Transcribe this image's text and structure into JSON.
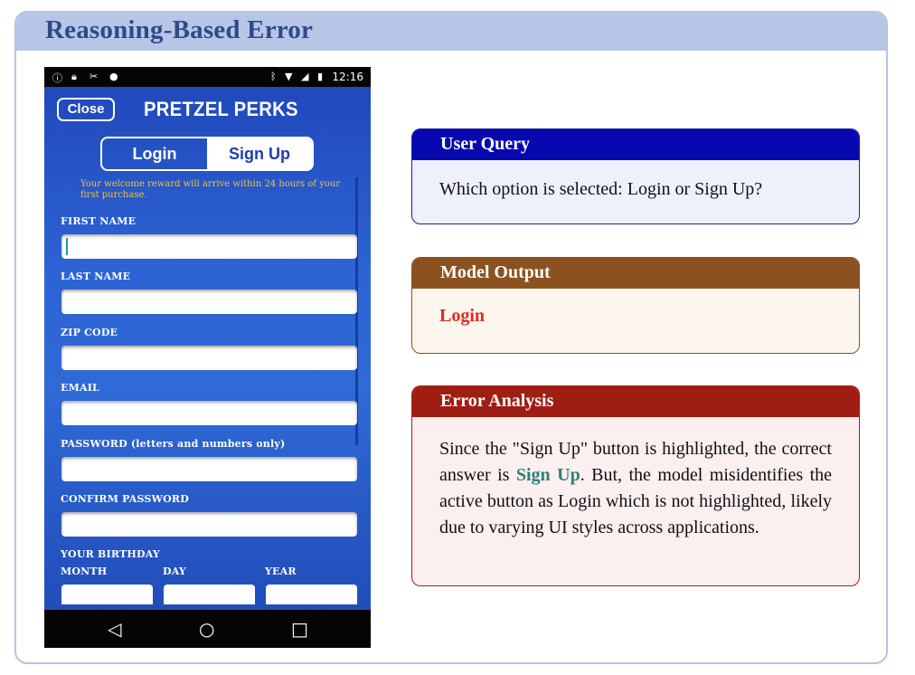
{
  "title": "Reasoning-Based Error",
  "phone": {
    "status_bar": {
      "time": "12:16"
    },
    "close_label": "Close",
    "app_name": "PRETZEL PERKS",
    "segmented": {
      "login": "Login",
      "signup": "Sign Up",
      "selected": "Sign Up"
    },
    "welcome_text": "Your welcome reward will arrive within 24 hours of your first purchase.",
    "fields": {
      "first_name": "FIRST NAME",
      "last_name": "LAST NAME",
      "zip": "ZIP CODE",
      "email": "EMAIL",
      "password": "PASSWORD (letters and numbers only)",
      "confirm_password": "CONFIRM PASSWORD",
      "birthday": "YOUR BIRTHDAY",
      "month": "MONTH",
      "day": "DAY",
      "year": "YEAR"
    }
  },
  "user_query": {
    "heading": "User Query",
    "text": "Which option is selected: Login or Sign Up?"
  },
  "model_output": {
    "heading": "Model Output",
    "text": "Login"
  },
  "error_analysis": {
    "heading": "Error Analysis",
    "text_before": "Since the \"Sign Up\" button is highlighted, the correct answer is ",
    "highlight": "Sign Up",
    "text_after": ".  But, the model misidentifies the active button as Login which is not highlighted, likely due to varying UI styles across applications."
  },
  "colors": {
    "frame_header": "#b7c6e6",
    "title": "#2f4a8c",
    "query_head": "#0808b0",
    "output_head": "#8b5220",
    "analysis_head": "#a01d13",
    "output_text": "#e02a22",
    "highlight": "#2e7f7a"
  }
}
